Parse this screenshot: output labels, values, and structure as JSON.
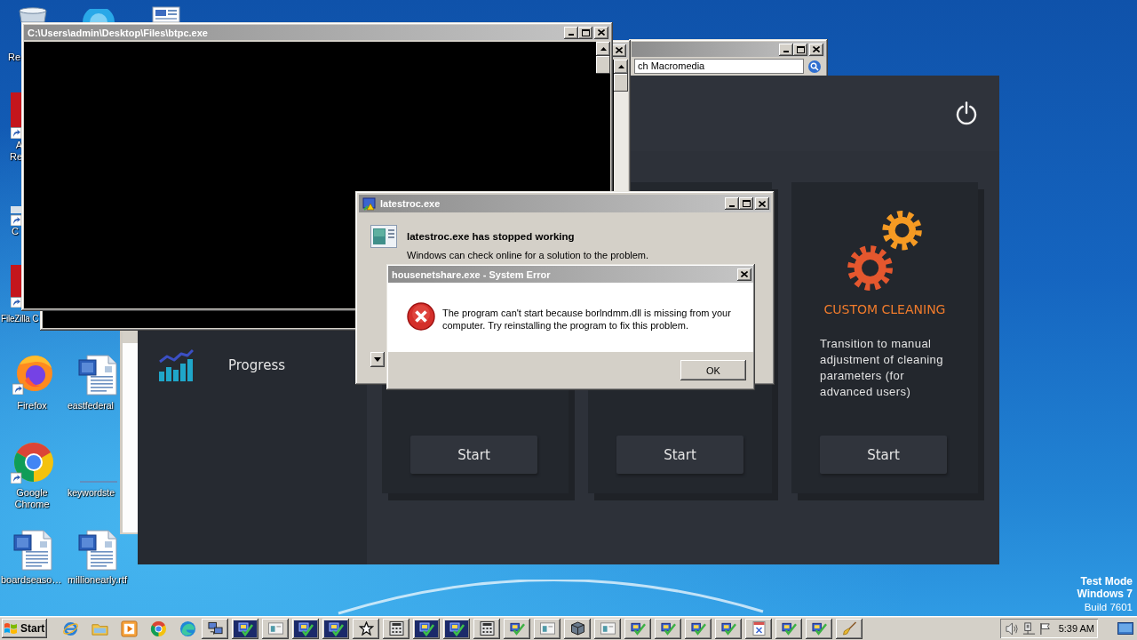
{
  "desktop_icons": [
    {
      "kind": "bin",
      "label": "Re"
    },
    {
      "kind": "round"
    },
    {
      "kind": "page-top"
    },
    {
      "kind": "shortcut-red",
      "label": "A Re"
    },
    {
      "kind": "shortcut",
      "label": "C"
    },
    {
      "kind": "shortcut-red",
      "label": "FileZilla C"
    },
    {
      "kind": "flame",
      "label": "Firefox"
    },
    {
      "kind": "word",
      "label": "eastfederal"
    },
    {
      "kind": "ring",
      "label": "Google Chrome"
    },
    {
      "kind": "blank",
      "label": "keywordste"
    },
    {
      "kind": "word",
      "label": "boardseaso…"
    },
    {
      "kind": "word",
      "label": "millionearly.rtf"
    }
  ],
  "search_window": {
    "search_text": "ch Macromedia"
  },
  "console_window": {
    "title": "C:\\Users\\admin\\Desktop\\Files\\btpc.exe"
  },
  "cleaner_app": {
    "sidebar": {
      "items": [
        {
          "label": "Progress"
        }
      ]
    },
    "cards": [
      {
        "button": "Start"
      },
      {
        "button": "Start"
      },
      {
        "title": "CUSTOM CLEANING",
        "description": "Transition to manual adjustment of cleaning parameters (for advanced users)",
        "button": "Start"
      }
    ]
  },
  "crash_dialog": {
    "title": "latestroc.exe",
    "heading": "latestroc.exe has stopped working",
    "text": "Windows can check online for a solution to the problem."
  },
  "error_dialog": {
    "title": "housenetshare.exe - System Error",
    "message": "The program can't start because borlndmm.dll is missing from your computer. Try reinstalling the program to fix this problem.",
    "button": "OK"
  },
  "system_notice": {
    "mode": "Test Mode",
    "os": "Windows 7",
    "build": "Build 7601"
  },
  "taskbar": {
    "start": "Start",
    "quick_launch": [
      {
        "kind": "e-globe"
      },
      {
        "kind": "folder"
      },
      {
        "kind": "play"
      },
      {
        "kind": "ring"
      },
      {
        "kind": "swirl"
      }
    ],
    "tasks": [
      {
        "kind": "network"
      },
      {
        "kind": "installer-dark"
      },
      {
        "kind": "window"
      },
      {
        "kind": "installer-dark"
      },
      {
        "kind": "installer-dark"
      },
      {
        "kind": "star"
      },
      {
        "kind": "calc"
      },
      {
        "kind": "installer-dark"
      },
      {
        "kind": "installer-dark"
      },
      {
        "kind": "calc"
      },
      {
        "kind": "installer"
      },
      {
        "kind": "window"
      },
      {
        "kind": "box"
      },
      {
        "kind": "window"
      },
      {
        "kind": "installer"
      },
      {
        "kind": "installer"
      },
      {
        "kind": "installer"
      },
      {
        "kind": "installer"
      },
      {
        "kind": "doc"
      },
      {
        "kind": "installer"
      },
      {
        "kind": "installer"
      },
      {
        "kind": "broom"
      }
    ],
    "clock": "5:39 AM"
  }
}
